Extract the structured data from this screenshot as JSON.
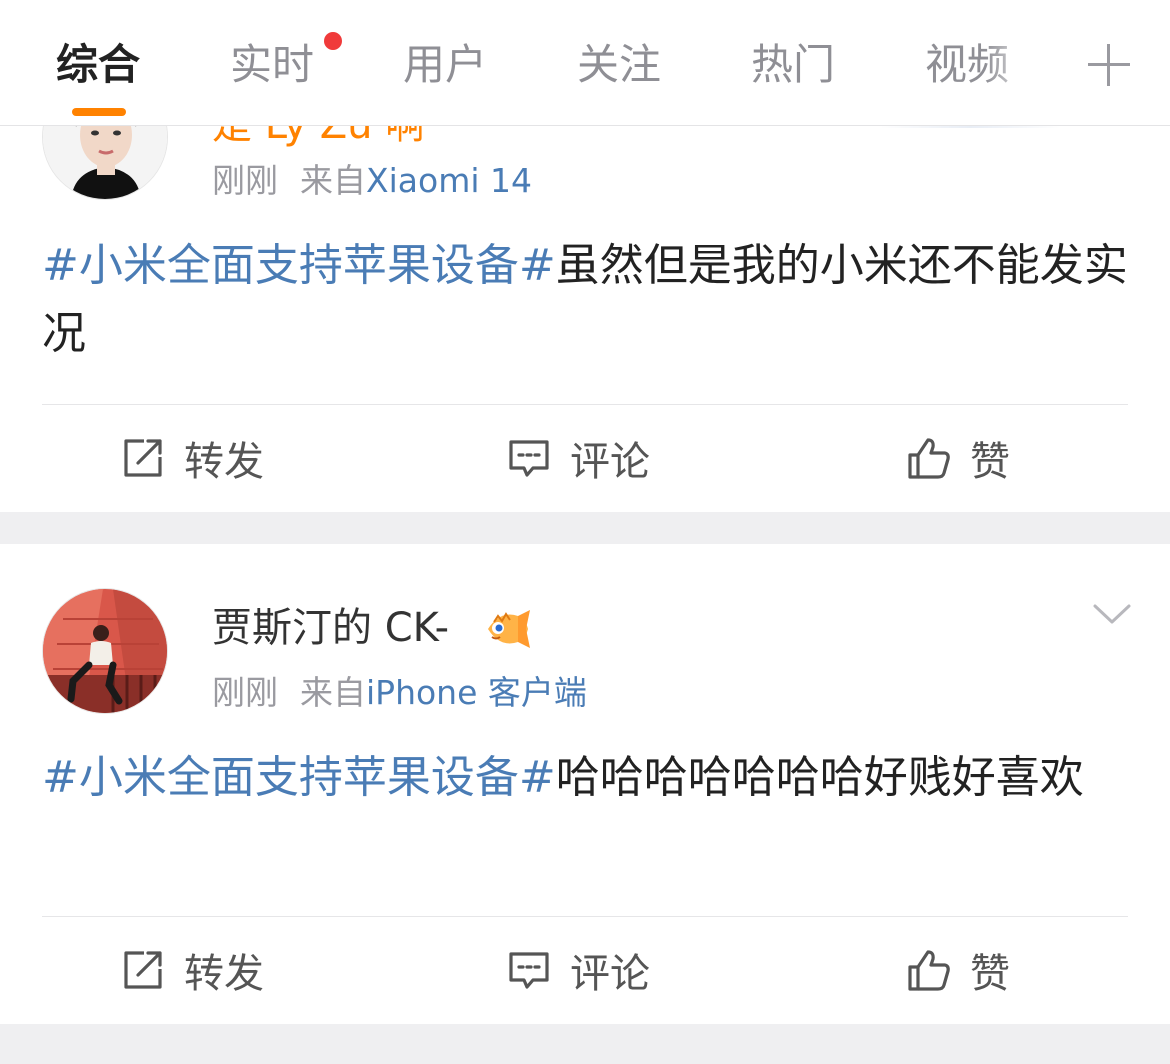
{
  "tabs": [
    {
      "label": "综合",
      "active": true
    },
    {
      "label": "实时",
      "active": false
    },
    {
      "label": "用户",
      "active": false
    },
    {
      "label": "关注",
      "active": false
    },
    {
      "label": "热门",
      "active": false
    },
    {
      "label": "视频",
      "active": false
    }
  ],
  "icons": {
    "add": "plus-icon",
    "repost": "repost-icon",
    "comment": "comment-icon",
    "like": "thumbs-up-icon",
    "more": "chevron-down-icon"
  },
  "colors": {
    "accent": "#ff8200",
    "link": "#4a7cb5",
    "notify_dot": "#f03a3a"
  },
  "posts": [
    {
      "name": "是 Ly Zu 啊",
      "time": "刚刚",
      "from_label": "来自",
      "source": "Xiaomi 14",
      "hashtag": "#小米全面支持苹果设备#",
      "text": "虽然但是我的小米还不能发实况",
      "actions": {
        "repost": "转发",
        "comment": "评论",
        "like": "赞"
      }
    },
    {
      "name": "贾斯汀的 CK-",
      "time": "刚刚",
      "from_label": "来自",
      "source": "iPhone 客户端",
      "hashtag": "#小米全面支持苹果设备#",
      "text": "哈哈哈哈哈哈哈好贱好喜欢",
      "actions": {
        "repost": "转发",
        "comment": "评论",
        "like": "赞"
      }
    }
  ]
}
